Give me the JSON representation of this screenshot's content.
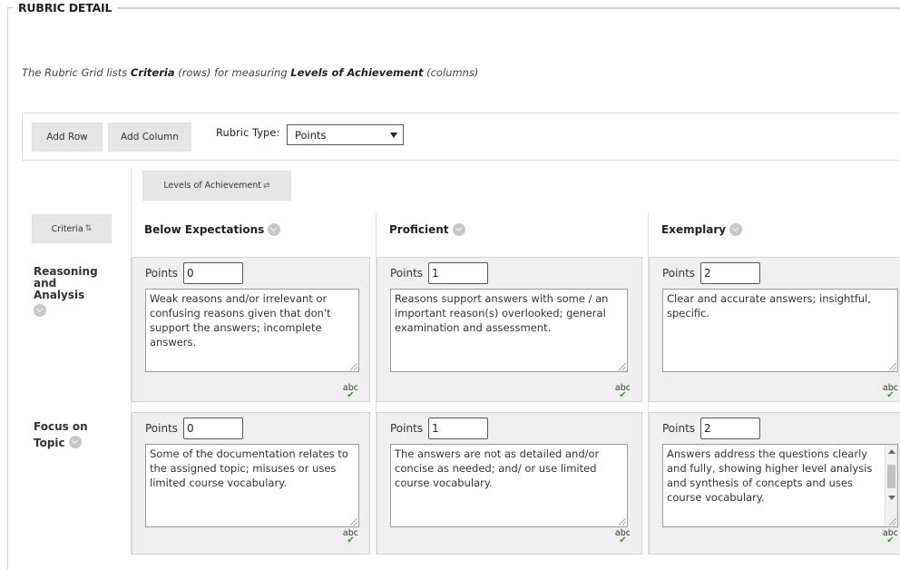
{
  "section": {
    "title": "RUBRIC DETAIL",
    "intro_prefix": "The Rubric Grid lists ",
    "intro_criteria": "Criteria",
    "intro_rows": " (rows) for measuring ",
    "intro_levels": "Levels of Achievement",
    "intro_cols": " (columns)"
  },
  "toolbar": {
    "add_row": "Add Row",
    "add_column": "Add Column",
    "rubric_type_label": "Rubric Type:",
    "rubric_type_value": "Points"
  },
  "grid": {
    "levels_button": "Levels of Achievement",
    "levels_arrows": "⇄",
    "criteria_button": "Criteria",
    "criteria_arrows": "⇅",
    "spell_label": "abc",
    "columns": [
      "Below Expectations",
      "Proficient",
      "Exemplary"
    ],
    "rows": [
      {
        "name": "Reasoning and Analysis",
        "cells": [
          {
            "points_label": "Points",
            "points": "0",
            "desc": "Weak reasons and/or irrelevant or confusing reasons given that don't support the answers; incomplete answers."
          },
          {
            "points_label": "Points",
            "points": "1",
            "desc": "Reasons support answers with some / an important reason(s) overlooked; general examination and assessment."
          },
          {
            "points_label": "Points",
            "points": "2",
            "desc": "Clear and accurate answers; insightful, specific."
          }
        ]
      },
      {
        "name": "Focus on Topic",
        "cells": [
          {
            "points_label": "Points",
            "points": "0",
            "desc": "Some of the documentation relates to the assigned topic; misuses or uses limited course vocabulary."
          },
          {
            "points_label": "Points",
            "points": "1",
            "desc": "The answers are not as detailed and/or concise as needed; and/ or use limited course vocabulary."
          },
          {
            "points_label": "Points",
            "points": "2",
            "desc": "Answers address the questions clearly and fully, showing higher level analysis and synthesis of concepts and uses course vocabulary."
          }
        ]
      }
    ]
  }
}
